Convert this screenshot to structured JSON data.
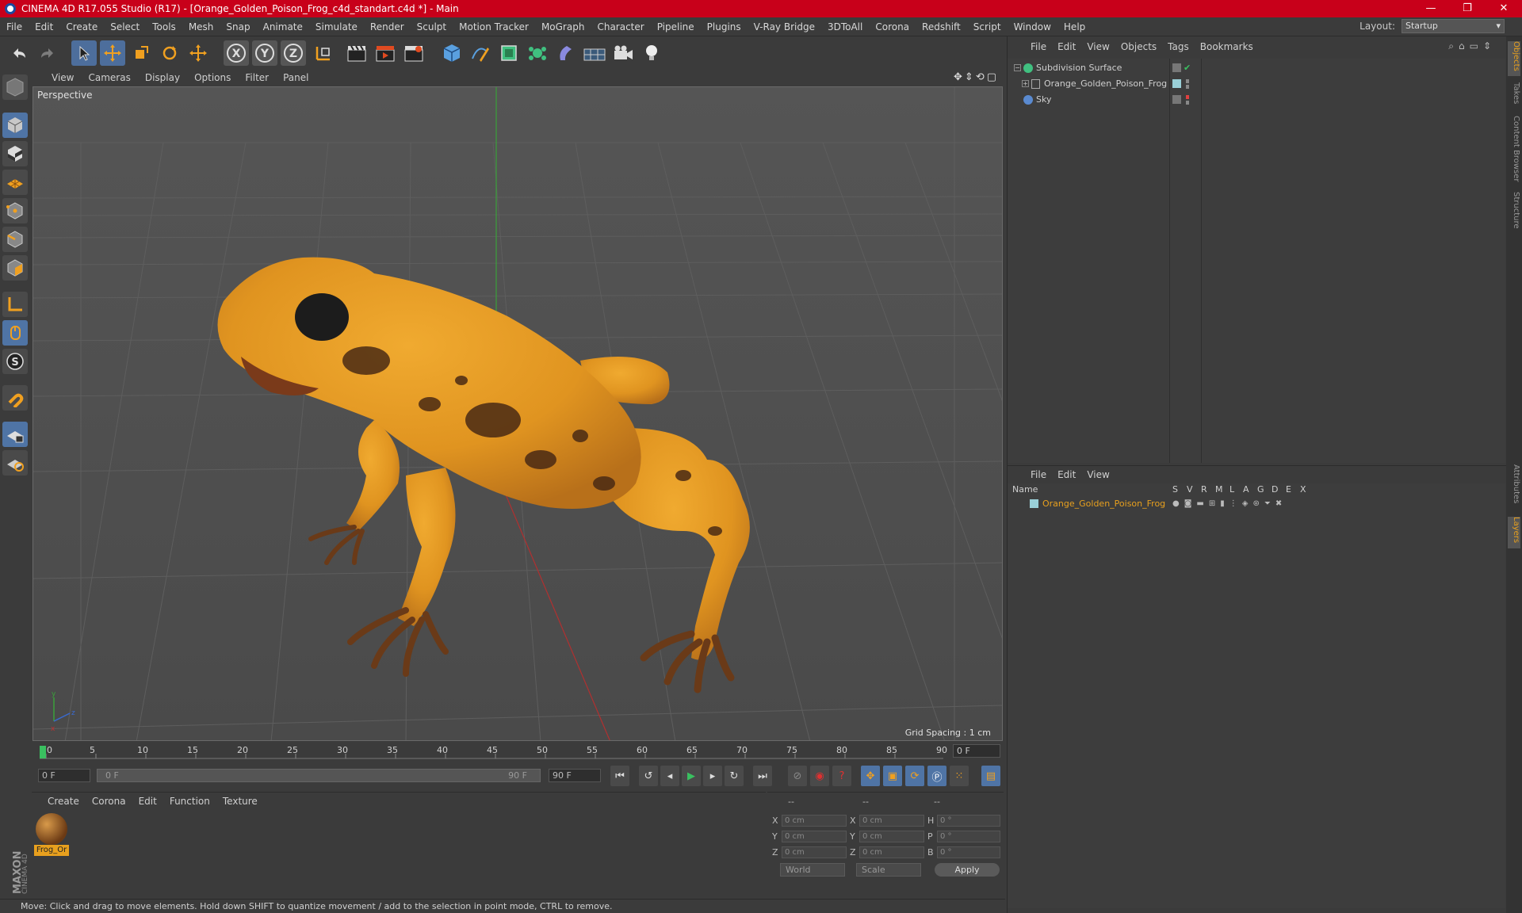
{
  "titlebar": {
    "title": "CINEMA 4D R17.055 Studio (R17) - [Orange_Golden_Poison_Frog_c4d_standart.c4d *] - Main",
    "minimize": "—",
    "restore": "❐",
    "close": "✕"
  },
  "menubar": {
    "items": [
      "File",
      "Edit",
      "Create",
      "Select",
      "Tools",
      "Mesh",
      "Snap",
      "Animate",
      "Simulate",
      "Render",
      "Sculpt",
      "Motion Tracker",
      "MoGraph",
      "Character",
      "Pipeline",
      "Plugins",
      "V-Ray Bridge",
      "3DToAll",
      "Corona",
      "Redshift",
      "Script",
      "Window",
      "Help"
    ],
    "layout_label": "Layout:",
    "layout_value": "Startup"
  },
  "toolbar": {
    "axis_x": "X",
    "axis_y": "Y",
    "axis_z": "Z"
  },
  "viewport": {
    "menu": [
      "View",
      "Cameras",
      "Display",
      "Options",
      "Filter",
      "Panel"
    ],
    "label": "Perspective",
    "grid_spacing": "Grid Spacing : 1 cm"
  },
  "timeline": {
    "ticks": [
      "0",
      "5",
      "10",
      "15",
      "20",
      "25",
      "30",
      "35",
      "40",
      "45",
      "50",
      "55",
      "60",
      "65",
      "70",
      "75",
      "80",
      "85",
      "90"
    ],
    "end_field": "0 F",
    "current_frame": "0 F",
    "slider_start": "0 F",
    "slider_end": "90 F",
    "max_frame": "90 F"
  },
  "material_manager": {
    "menu": [
      "Create",
      "Corona",
      "Edit",
      "Function",
      "Texture"
    ],
    "material_label": "Frog_Or"
  },
  "coords": {
    "header": [
      "--",
      "--",
      "--"
    ],
    "rows": [
      {
        "l1": "X",
        "v1": "0 cm",
        "l2": "X",
        "v2": "0 cm",
        "l3": "H",
        "v3": "0 °"
      },
      {
        "l1": "Y",
        "v1": "0 cm",
        "l2": "Y",
        "v2": "0 cm",
        "l3": "P",
        "v3": "0 °"
      },
      {
        "l1": "Z",
        "v1": "0 cm",
        "l2": "Z",
        "v2": "0 cm",
        "l3": "B",
        "v3": "0 °"
      }
    ],
    "space": "World",
    "mode": "Scale",
    "apply": "Apply"
  },
  "statusbar": {
    "text": "Move: Click and drag to move elements. Hold down SHIFT to quantize movement / add to the selection in point mode, CTRL to remove."
  },
  "object_manager": {
    "menu": [
      "File",
      "Edit",
      "View",
      "Objects",
      "Tags",
      "Bookmarks"
    ],
    "objects": [
      {
        "name": "Subdivision Surface"
      },
      {
        "name": "Orange_Golden_Poison_Frog"
      },
      {
        "name": "Sky"
      }
    ]
  },
  "layer_manager": {
    "menu": [
      "File",
      "Edit",
      "View"
    ],
    "columns": [
      "Name",
      "S",
      "V",
      "R",
      "M",
      "L",
      "A",
      "G",
      "D",
      "E",
      "X"
    ],
    "layers": [
      {
        "name": "Orange_Golden_Poison_Frog",
        "color": "#e8a01e"
      }
    ]
  },
  "side_tabs": [
    "Objects",
    "Takes",
    "Content Browser",
    "Structure",
    "Attributes",
    "Layers"
  ],
  "maxon_logo": "MAXON CINEMA 4D",
  "colors": {
    "titlebar": "#c8001a",
    "accent_orange": "#e8a01e",
    "tool_blue": "#4f74a5"
  }
}
